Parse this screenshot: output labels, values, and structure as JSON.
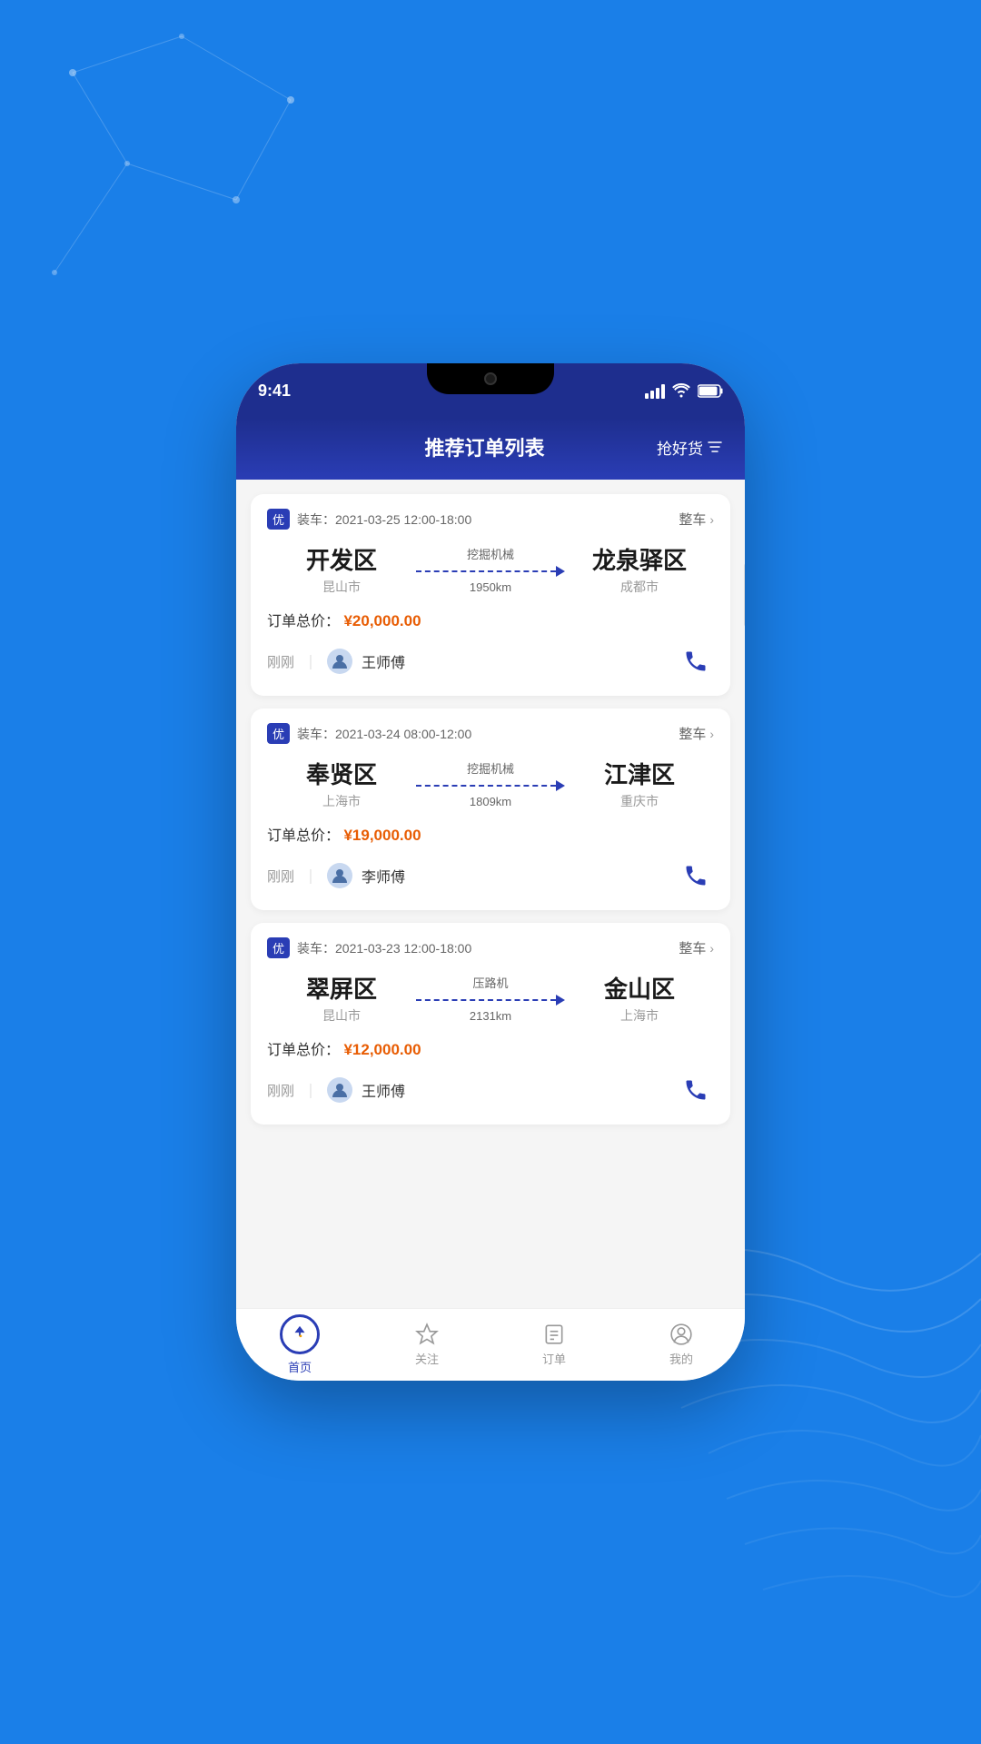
{
  "background": {
    "color": "#1a7fe8"
  },
  "phone": {
    "status_bar": {
      "time": "9:41",
      "signal_label": "signal",
      "wifi_label": "wifi",
      "battery_label": "battery"
    },
    "header": {
      "title": "推荐订单列表",
      "action": "抢好货"
    },
    "orders": [
      {
        "id": "order-1",
        "badge": "优",
        "load_time": "装车：2021-03-25 12:00-18:00",
        "type": "整车",
        "from_name": "开发区",
        "from_city": "昆山市",
        "cargo": "挖掘机械",
        "distance": "1950km",
        "to_name": "龙泉驿区",
        "to_city": "成都市",
        "price_label": "订单总价：",
        "price": "¥20,000.00",
        "time_ago": "刚刚",
        "driver_name": "王师傅"
      },
      {
        "id": "order-2",
        "badge": "优",
        "load_time": "装车：2021-03-24 08:00-12:00",
        "type": "整车",
        "from_name": "奉贤区",
        "from_city": "上海市",
        "cargo": "挖掘机械",
        "distance": "1809km",
        "to_name": "江津区",
        "to_city": "重庆市",
        "price_label": "订单总价：",
        "price": "¥19,000.00",
        "time_ago": "刚刚",
        "driver_name": "李师傅"
      },
      {
        "id": "order-3",
        "badge": "优",
        "load_time": "装车：2021-03-23 12:00-18:00",
        "type": "整车",
        "from_name": "翠屏区",
        "from_city": "昆山市",
        "cargo": "压路机",
        "distance": "2131km",
        "to_name": "金山区",
        "to_city": "上海市",
        "price_label": "订单总价：",
        "price": "¥12,000.00",
        "time_ago": "刚刚",
        "driver_name": "王师傅"
      }
    ],
    "nav": {
      "items": [
        {
          "id": "home",
          "label": "首页",
          "active": true
        },
        {
          "id": "follow",
          "label": "关注",
          "active": false
        },
        {
          "id": "orders",
          "label": "订单",
          "active": false
        },
        {
          "id": "mine",
          "label": "我的",
          "active": false
        }
      ]
    }
  }
}
